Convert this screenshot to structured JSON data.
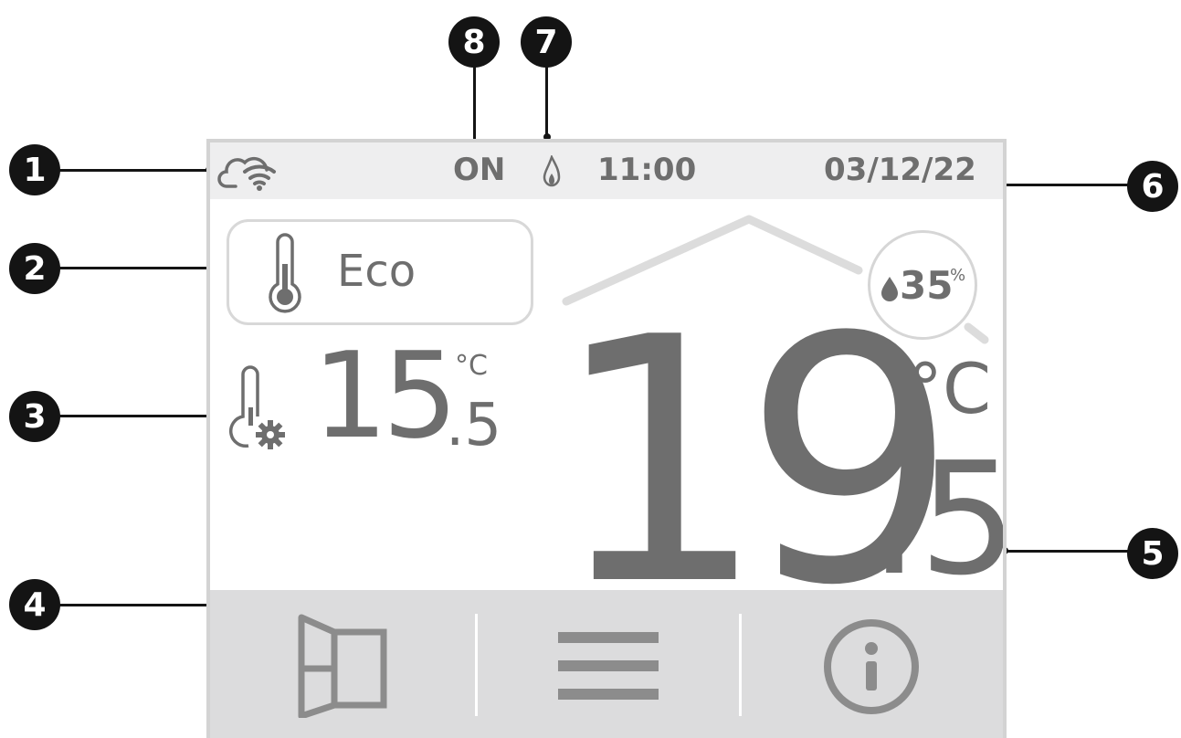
{
  "callouts": [
    "1",
    "2",
    "3",
    "4",
    "5",
    "6",
    "7",
    "8"
  ],
  "status_bar": {
    "power_state": "ON",
    "time": "11:00",
    "date": "03/12/22",
    "icons": [
      "cloud-wifi-icon",
      "flame-icon"
    ]
  },
  "mode": {
    "label": "Eco",
    "icon": "thermometer-icon"
  },
  "setpoint": {
    "integer": "15",
    "decimal": ".5",
    "unit": "°C",
    "icon": "thermometer-gear-icon"
  },
  "temperature": {
    "integer": "19",
    "decimal": ".5",
    "unit": "°C"
  },
  "humidity": {
    "value": "35",
    "unit": "%",
    "icon": "water-drop-icon"
  },
  "nav": {
    "buttons": [
      "open-window-icon",
      "menu-icon",
      "info-icon"
    ]
  },
  "colors": {
    "badge": "#141414",
    "text": "#6e6e6e",
    "status_bar_bg": "#eeeeef",
    "nav_bg": "#dcdcdd",
    "frame": "#d3d3d3"
  }
}
